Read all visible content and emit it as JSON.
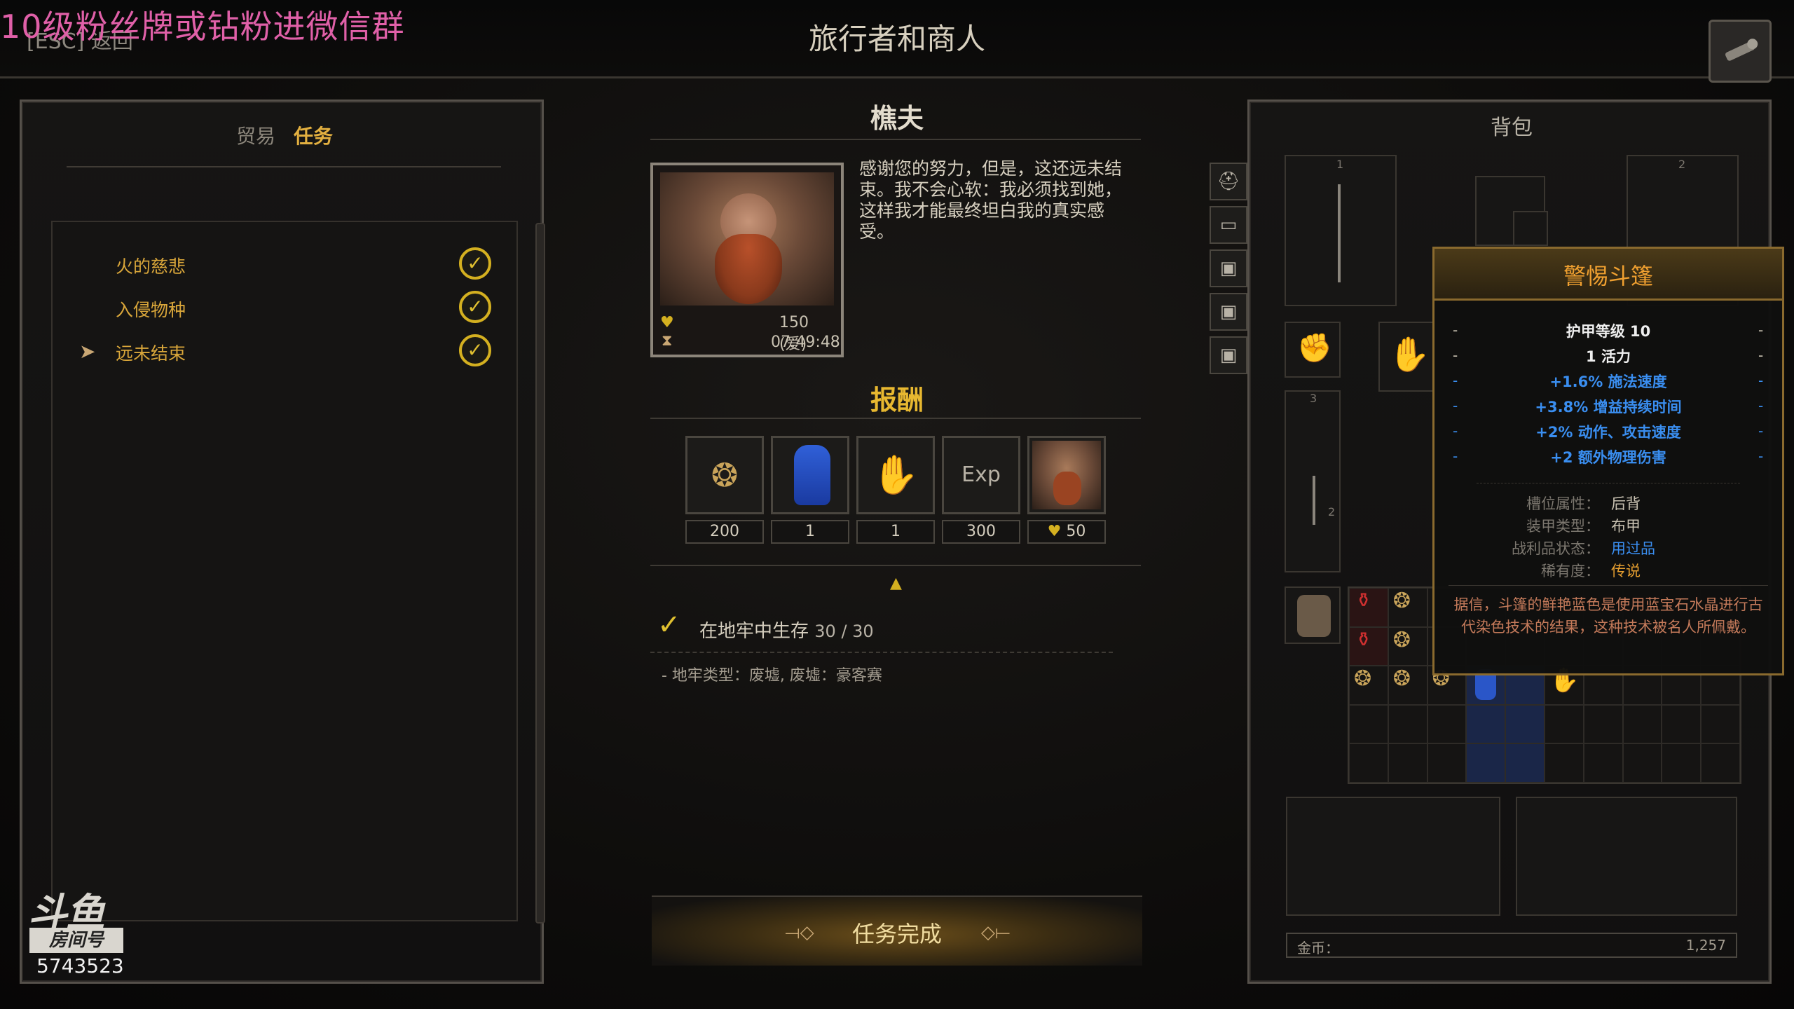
{
  "stream": {
    "banner": "10级粉丝牌或钻粉进微信群",
    "logo_main": "斗鱼",
    "logo_room": "房间号",
    "room_id": "5743523"
  },
  "header": {
    "esc_back": "[ESC] 返回",
    "title": "旅行者和商人"
  },
  "left": {
    "tabs": [
      {
        "label": "贸易",
        "active": false
      },
      {
        "label": "任务",
        "active": true
      }
    ],
    "quests": [
      {
        "label": "火的慈悲",
        "complete": true,
        "selected": false
      },
      {
        "label": "入侵物种",
        "complete": true,
        "selected": false
      },
      {
        "label": "远未结束",
        "complete": true,
        "selected": true
      }
    ]
  },
  "npc": {
    "name": "樵夫",
    "affinity": "150 (爱)",
    "timer": "07:49:48",
    "dialog": "感谢您的努力，但是，这还远未结束。我不会心软：我必须找到她，这样我才能最终坦白我的真实感受。"
  },
  "reward": {
    "title": "报酬",
    "items": [
      {
        "icon": "gold-coins-icon",
        "value": "200"
      },
      {
        "icon": "blue-cloak-icon",
        "value": "1"
      },
      {
        "icon": "gloves-icon",
        "value": "1"
      },
      {
        "icon": "exp-icon",
        "label": "Exp",
        "value": "300"
      },
      {
        "icon": "npc-portrait-icon",
        "value": "50"
      }
    ]
  },
  "objective": {
    "text": "在地牢中生存",
    "progress": "30 / 30",
    "detail": "- 地牢类型：废墟, 废墟：豪客赛"
  },
  "complete_button": {
    "label": "任务完成"
  },
  "bag": {
    "title": "背包",
    "gold_label": "金币：",
    "gold_value": "1,257",
    "slot_numbers": [
      "1",
      "2",
      "3",
      "2"
    ]
  },
  "tooltip": {
    "title": "警惕斗篷",
    "armor": "护甲等级 10",
    "vitality": "1 活力",
    "stats": [
      "+1.6% 施法速度",
      "+3.8% 增益持续时间",
      "+2% 动作、攻击速度",
      "+2 额外物理伤害"
    ],
    "props": [
      {
        "key": "槽位属性：",
        "value": "后背",
        "color": "#c9c2b2"
      },
      {
        "key": "装甲类型：",
        "value": "布甲",
        "color": "#c9c2b2"
      },
      {
        "key": "战利品状态：",
        "value": "用过品",
        "color": "#3a8ef0"
      },
      {
        "key": "稀有度：",
        "value": "传说",
        "color": "#e8a030"
      }
    ],
    "description": "据信，斗篷的鲜艳蓝色是使用蓝宝石水晶进行古代染色技术的结果，这种技术被名人所佩戴。"
  },
  "colors": {
    "accent_gold": "#e8b830",
    "quest_gold": "#d9a63a",
    "stat_blue": "#3a8ef0",
    "legend_orange": "#f0a030"
  }
}
